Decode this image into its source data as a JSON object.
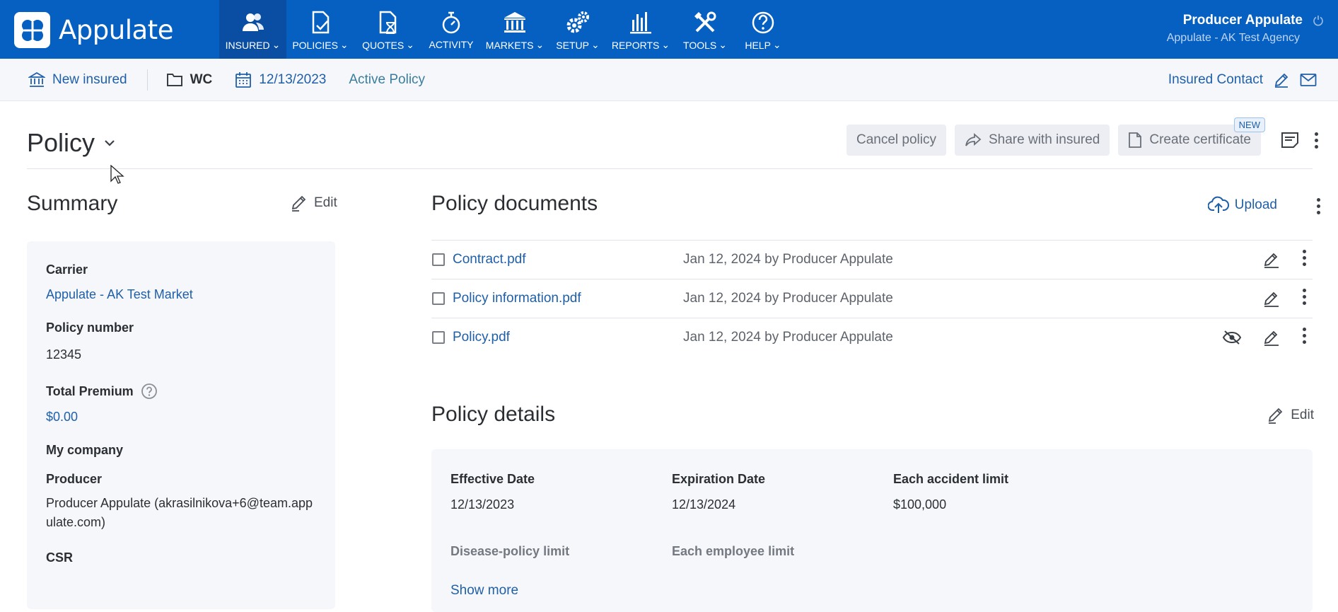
{
  "app": {
    "name": "Appulate"
  },
  "nav": {
    "items": [
      {
        "label": "INSURED",
        "icon": "users-icon",
        "active": true
      },
      {
        "label": "POLICIES",
        "icon": "policy-check-icon",
        "active": false
      },
      {
        "label": "QUOTES",
        "icon": "quote-hourglass-icon",
        "active": false
      },
      {
        "label": "ACTIVITY",
        "icon": "stopwatch-icon",
        "active": false
      },
      {
        "label": "MARKETS",
        "icon": "bank-icon",
        "active": false
      },
      {
        "label": "SETUP",
        "icon": "gears-icon",
        "active": false
      },
      {
        "label": "REPORTS",
        "icon": "bar-chart-icon",
        "active": false
      },
      {
        "label": "TOOLS",
        "icon": "tools-icon",
        "active": false
      },
      {
        "label": "HELP",
        "icon": "help-icon",
        "active": false
      }
    ]
  },
  "user": {
    "name": "Producer Appulate",
    "agency": "Appulate - AK Test Agency"
  },
  "subbar": {
    "insured": "New insured",
    "line": "WC",
    "date": "12/13/2023",
    "status": "Active Policy",
    "contact": "Insured Contact"
  },
  "page": {
    "title": "Policy"
  },
  "actions": {
    "cancel": "Cancel policy",
    "share": "Share with insured",
    "certificate": "Create certificate",
    "new_badge": "NEW"
  },
  "summary": {
    "title": "Summary",
    "edit": "Edit",
    "carrier_label": "Carrier",
    "carrier_value": "Appulate - AK Test Market",
    "policy_number_label": "Policy number",
    "policy_number_value": "12345",
    "premium_label": "Total Premium",
    "premium_value": "$0.00",
    "my_company_label": "My company",
    "producer_label": "Producer",
    "producer_value": "Producer Appulate (akrasilnikova+6@team.appulate.com)",
    "csr_label": "CSR"
  },
  "documents": {
    "title": "Policy documents",
    "upload": "Upload",
    "rows": [
      {
        "name": "Contract.pdf",
        "meta": "Jan 12, 2024 by Producer Appulate",
        "hidden": false
      },
      {
        "name": "Policy information.pdf",
        "meta": "Jan 12, 2024 by Producer Appulate",
        "hidden": false
      },
      {
        "name": "Policy.pdf",
        "meta": "Jan 12, 2024 by Producer Appulate",
        "hidden": true
      }
    ]
  },
  "details": {
    "title": "Policy details",
    "edit": "Edit",
    "effective_label": "Effective Date",
    "effective_value": "12/13/2023",
    "expiration_label": "Expiration Date",
    "expiration_value": "12/13/2024",
    "accident_label": "Each accident limit",
    "accident_value": "$100,000",
    "disease_label": "Disease-policy limit",
    "employee_label": "Each employee limit",
    "show_more": "Show more"
  },
  "colors": {
    "brand": "#0660c2",
    "link": "#1f5fa8"
  }
}
